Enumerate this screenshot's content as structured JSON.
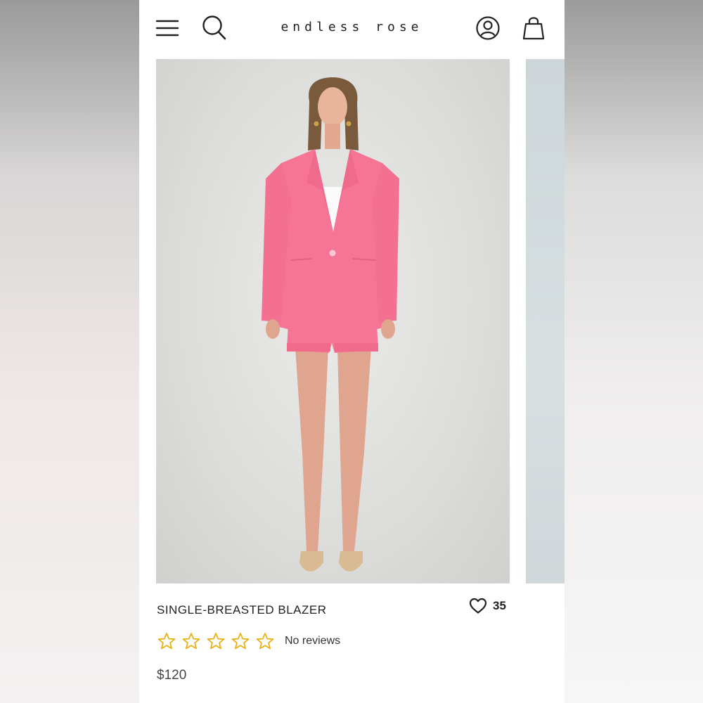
{
  "header": {
    "brand": "endless rose",
    "icons": [
      "menu-icon",
      "search-icon",
      "account-icon",
      "shopping-bag-icon"
    ]
  },
  "gallery": {
    "image_alt": "Model wearing pink single-breasted blazer with matching shorts"
  },
  "product": {
    "title": "SINGLE-BREASTED BLAZER",
    "wishlist_count": "35",
    "rating": 0,
    "rating_max": 5,
    "reviews_text": "No reviews",
    "price": "$120"
  },
  "colors": {
    "star_outline": "#e8b21a",
    "blazer_pink": "#f67596",
    "text": "#222222"
  }
}
